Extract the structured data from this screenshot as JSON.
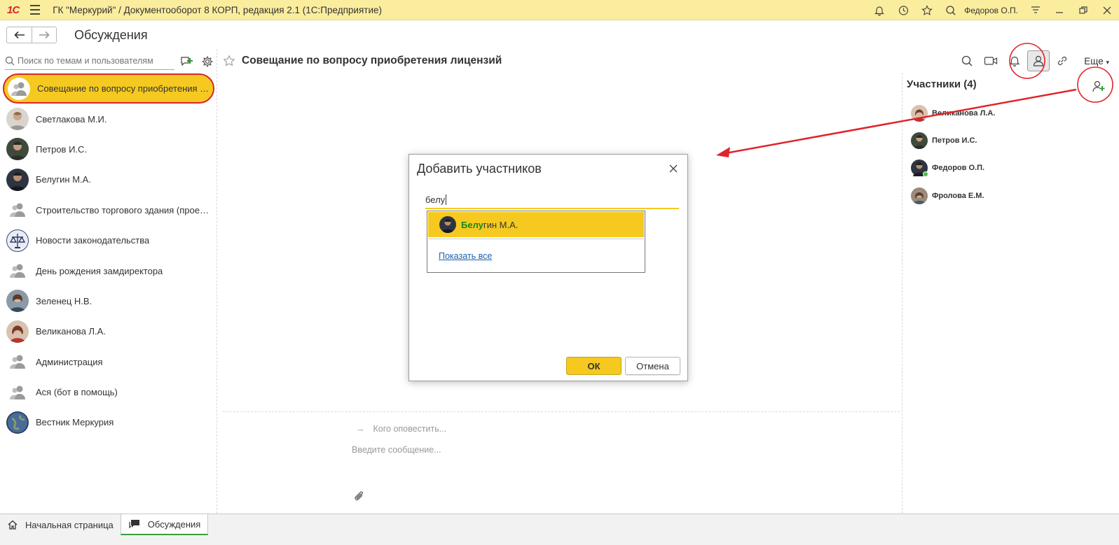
{
  "app": {
    "logo": "1С",
    "title": "ГК \"Меркурий\" / Документооборот 8 КОРП, редакция 2.1  (1С:Предприятие)",
    "user": "Федоров О.П."
  },
  "nav": {
    "page_title": "Обсуждения"
  },
  "left": {
    "search_placeholder": "Поиск по темам и пользователям",
    "items": [
      {
        "label": "Совещание по вопросу приобретения лицензий",
        "icon": "group-icon"
      },
      {
        "label": "Светлакова М.И.",
        "icon": "user-photo"
      },
      {
        "label": "Петров И.С.",
        "icon": "user-photo"
      },
      {
        "label": "Белугин М.А.",
        "icon": "user-photo"
      },
      {
        "label": "Строительство торгового здания (проект)",
        "icon": "group-icon"
      },
      {
        "label": "Новости законодательства",
        "icon": "emblem-icon"
      },
      {
        "label": "День рождения замдиректора",
        "icon": "group-icon"
      },
      {
        "label": "Зеленец Н.В.",
        "icon": "user-photo"
      },
      {
        "label": "Великанова Л.А.",
        "icon": "user-photo"
      },
      {
        "label": "Администрация",
        "icon": "group-icon"
      },
      {
        "label": "Ася (бот в помощь)",
        "icon": "group-icon"
      },
      {
        "label": "Вестник Меркурия",
        "icon": "globe-icon"
      }
    ]
  },
  "conversation": {
    "title": "Совещание по вопросу приобретения лицензий",
    "more_label": "Еще",
    "notify_placeholder": "Кого оповестить...",
    "message_placeholder": "Введите сообщение..."
  },
  "participants": {
    "title": "Участники (4)",
    "items": [
      {
        "label": "Великанова Л.А."
      },
      {
        "label": "Петров И.С."
      },
      {
        "label": "Федоров О.П."
      },
      {
        "label": "Фролова Е.М."
      }
    ]
  },
  "dialog": {
    "title": "Добавить участников",
    "input_value": "белу",
    "suggestion_match": "Белу",
    "suggestion_rest": "гин М.А.",
    "show_all": "Показать все",
    "ok": "ОК",
    "cancel": "Отмена"
  },
  "bottom_tabs": [
    {
      "label": "Начальная страница"
    },
    {
      "label": "Обсуждения"
    }
  ],
  "colors": {
    "accent": "#f5c920",
    "titlebar": "#fbed9e",
    "annotation": "#e0242b",
    "match": "#1a8a1a"
  }
}
